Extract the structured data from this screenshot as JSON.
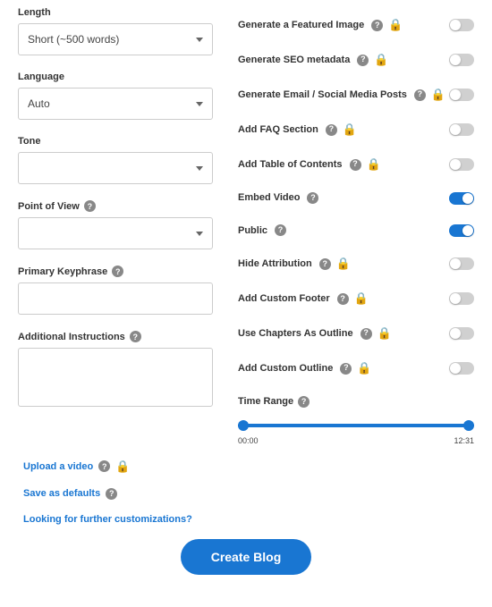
{
  "left": {
    "length": {
      "label": "Length",
      "value": "Short (~500 words)"
    },
    "language": {
      "label": "Language",
      "value": "Auto"
    },
    "tone": {
      "label": "Tone",
      "value": ""
    },
    "pov": {
      "label": "Point of View",
      "value": ""
    },
    "keyphrase": {
      "label": "Primary Keyphrase",
      "value": ""
    },
    "instructions": {
      "label": "Additional Instructions",
      "value": ""
    }
  },
  "toggles": {
    "featured_image": {
      "label": "Generate a Featured Image"
    },
    "seo": {
      "label": "Generate SEO metadata"
    },
    "social": {
      "label": "Generate Email / Social Media Posts"
    },
    "faq": {
      "label": "Add FAQ Section"
    },
    "toc": {
      "label": "Add Table of Contents"
    },
    "embed_video": {
      "label": "Embed Video"
    },
    "public": {
      "label": "Public"
    },
    "hide_attr": {
      "label": "Hide Attribution"
    },
    "custom_footer": {
      "label": "Add Custom Footer"
    },
    "chapters": {
      "label": "Use Chapters As Outline"
    },
    "custom_outline": {
      "label": "Add Custom Outline"
    }
  },
  "time_range": {
    "label": "Time Range",
    "start": "00:00",
    "end": "12:31"
  },
  "links": {
    "upload": "Upload a video",
    "save_defaults": "Save as defaults",
    "customizations": "Looking for further customizations?"
  },
  "create_btn": "Create Blog"
}
